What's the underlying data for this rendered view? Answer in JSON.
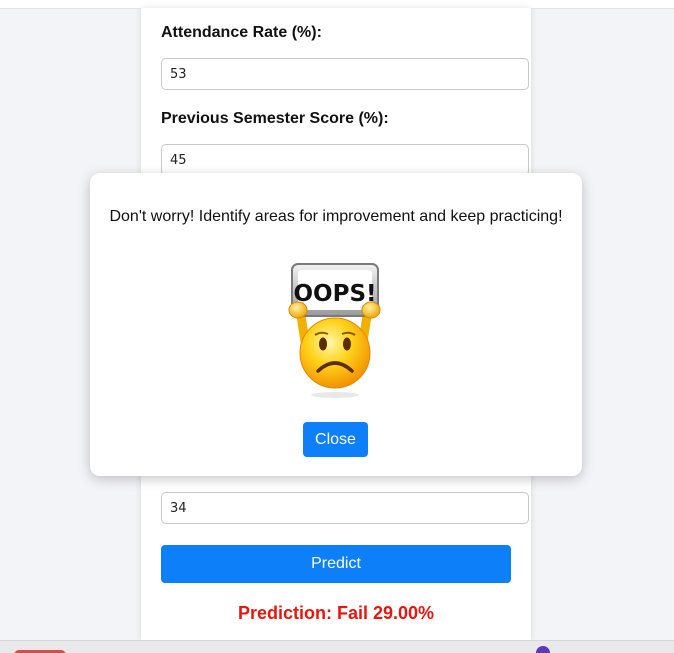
{
  "form": {
    "attendance_label": "Attendance Rate (%):",
    "attendance_value": "53",
    "previous_score_label": "Previous Semester Score (%):",
    "previous_score_value": "45",
    "hidden_field_value": "34",
    "predict_label": "Predict",
    "prediction_text": "Prediction: Fail 29.00%"
  },
  "modal": {
    "message": "Don't worry! Identify areas for improvement and keep practicing!",
    "image_text": "OOPS!",
    "close_label": "Close"
  },
  "colors": {
    "accent": "#0d7ff8",
    "fail": "#e8160c"
  },
  "icons": {
    "modal_image": "oops-sad-emoji-icon"
  }
}
